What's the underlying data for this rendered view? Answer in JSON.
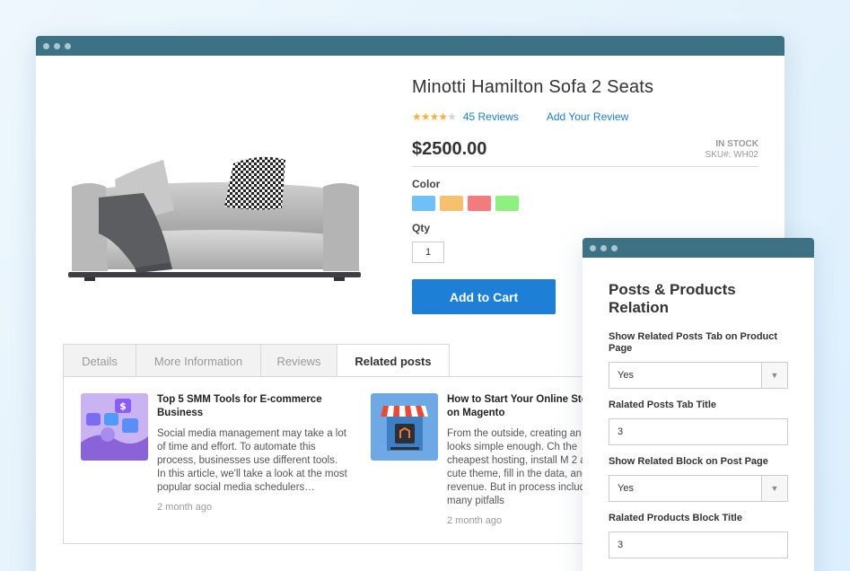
{
  "product": {
    "title": "Minotti Hamilton Sofa 2 Seats",
    "rating": 4,
    "rating_max": 5,
    "reviews_link": "45 Reviews",
    "add_review_link": "Add Your Review",
    "price": "$2500.00",
    "stock_status": "IN STOCK",
    "sku": "SKU#: WH02",
    "color_label": "Color",
    "colors": [
      "#6ec0f7",
      "#f5c16e",
      "#f27b7b",
      "#8ef07e"
    ],
    "qty_label": "Qty",
    "qty_value": "1",
    "add_to_cart": "Add to Cart"
  },
  "tabs": [
    {
      "label": "Details",
      "active": false
    },
    {
      "label": "More Information",
      "active": false
    },
    {
      "label": "Reviews",
      "active": false
    },
    {
      "label": "Related posts",
      "active": true
    }
  ],
  "posts": [
    {
      "title": "Top 5 SMM Tools for E-commerce Business",
      "excerpt": "Social media management may take a lot of time and effort. To automate this process, businesses use different tools. In this article, we'll take a look at the most popular social media schedulers…",
      "date": "2 month ago"
    },
    {
      "title": "How to Start Your Online Store on Magento",
      "excerpt": "From the outside, creating an store looks simple enough. Ch the cheapest hosting, install M 2 and a cute theme, fill in the data, and get revenue. But in process includes many pitfalls",
      "date": "2 month ago"
    }
  ],
  "config": {
    "title": "Posts & Products Relation",
    "fields": [
      {
        "label": "Show Related Posts Tab on Product Page",
        "value": "Yes",
        "type": "select"
      },
      {
        "label": "Ralated Posts Tab Title",
        "value": "3",
        "type": "text"
      },
      {
        "label": "Show Related Block on Post Page",
        "value": "Yes",
        "type": "select"
      },
      {
        "label": "Ralated Products Block Title",
        "value": "3",
        "type": "text"
      }
    ]
  }
}
